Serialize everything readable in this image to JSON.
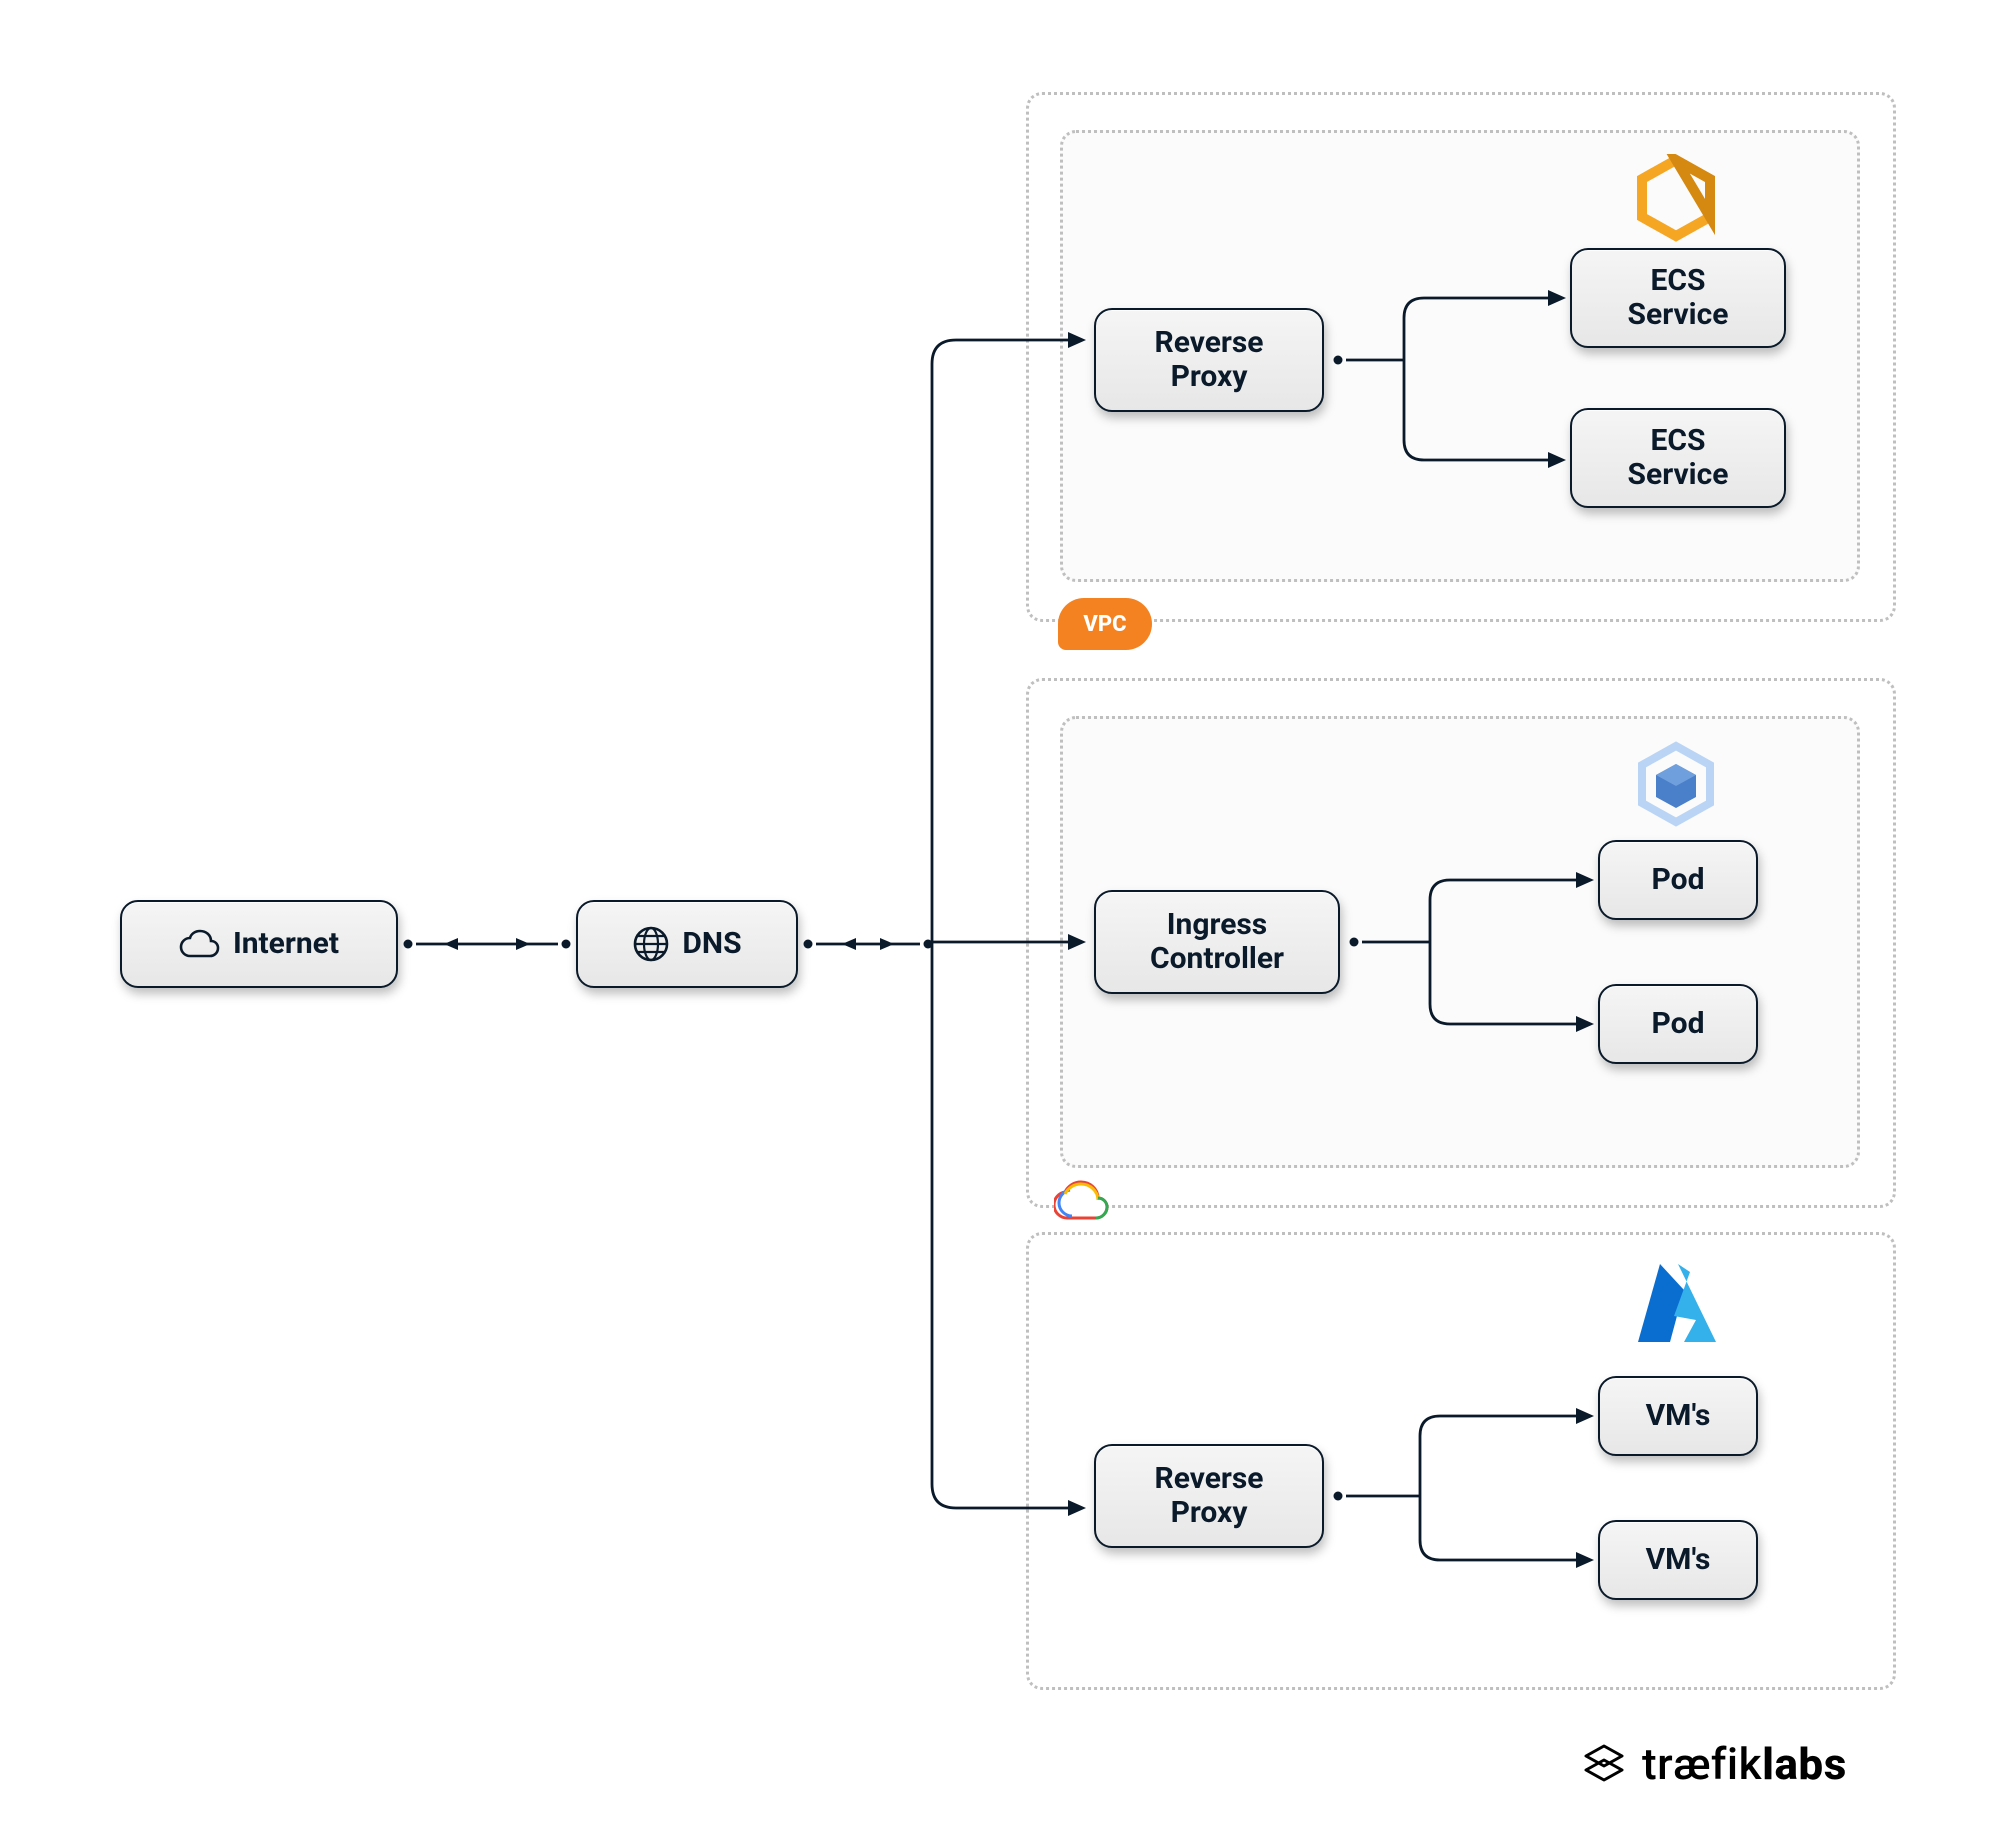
{
  "nodes": {
    "internet": {
      "label": "Internet"
    },
    "dns": {
      "label": "DNS"
    },
    "aws_proxy": {
      "label": "Reverse\nProxy"
    },
    "aws_svc1": {
      "label": "ECS\nService"
    },
    "aws_svc2": {
      "label": "ECS\nService"
    },
    "gcp_ctrl": {
      "label": "Ingress\nController"
    },
    "gcp_pod1": {
      "label": "Pod"
    },
    "gcp_pod2": {
      "label": "Pod"
    },
    "az_proxy": {
      "label": "Reverse\nProxy"
    },
    "az_vm1": {
      "label": "VM's"
    },
    "az_vm2": {
      "label": "VM's"
    }
  },
  "badges": {
    "vpc": "VPC"
  },
  "brand": {
    "text_thin": "træfik",
    "text_bold": "labs"
  },
  "icons": {
    "internet": "cloud-icon",
    "dns": "globe-icon",
    "aws": "aws-hex-icon",
    "gke": "gke-hex-icon",
    "gcp": "gcp-cloud-icon",
    "azure": "azure-a-icon",
    "traefik": "traefik-logo-icon"
  }
}
